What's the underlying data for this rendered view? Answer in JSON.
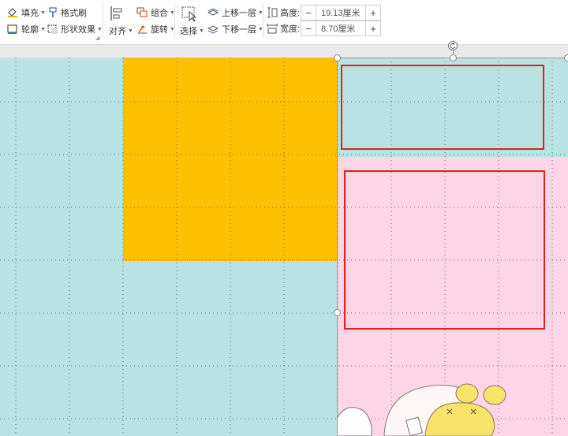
{
  "toolbar": {
    "fill_label": "填充",
    "format_painter_label": "格式刷",
    "outline_label": "轮廓",
    "shape_effects_label": "形状效果",
    "align_label": "对齐",
    "group_label": "组合",
    "rotate_label": "旋转",
    "select_label": "选择",
    "bring_forward_label": "上移一层",
    "send_backward_label": "下移一层",
    "height_label": "高度:",
    "height_value": "19.13厘米",
    "width_label": "宽度:",
    "width_value": "8.70厘米",
    "minus": "−",
    "plus": "+"
  },
  "colors": {
    "canvas_teal": "#b9e2e2",
    "block_yellow": "#fdc000",
    "block_pink": "#fcd6e6",
    "highlight_red": "#e02020"
  },
  "icons": [
    "fill-icon",
    "format-painter-icon",
    "outline-icon",
    "shape-effects-icon",
    "align-icon",
    "group-icon",
    "rotate-icon",
    "select-icon",
    "bring-forward-icon",
    "send-backward-icon",
    "height-icon",
    "width-icon",
    "rotation-handle-icon"
  ]
}
